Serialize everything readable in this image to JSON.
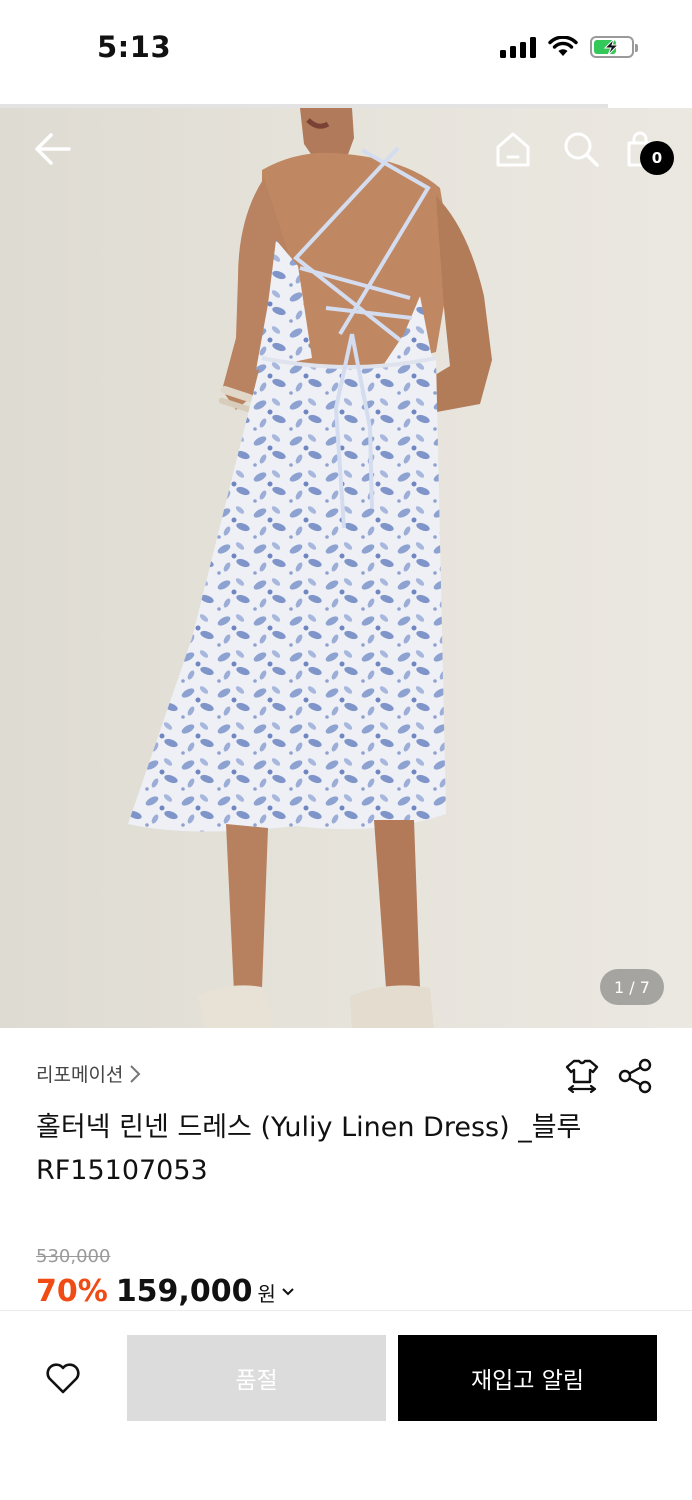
{
  "status_bar": {
    "time": "5:13",
    "icons": [
      "signal-icon",
      "wifi-icon",
      "battery-charging-icon"
    ]
  },
  "header": {
    "cart_count": "0",
    "icons": [
      "back-arrow-icon",
      "home-icon",
      "search-icon",
      "shopping-bag-icon"
    ]
  },
  "gallery": {
    "counter": "1 / 7",
    "current": 1,
    "total": 7
  },
  "product": {
    "brand": "리포메이션",
    "title": "홀터넥 린넨 드레스 (Yuliy Linen Dress) _블루",
    "code": "RF15107053",
    "original_price": "530,000",
    "discount_rate": "70%",
    "sale_price": "159,000",
    "currency": "원"
  },
  "actions": {
    "soldout_label": "품절",
    "restock_label": "재입고 알림",
    "icons": [
      "heart-icon",
      "size-guide-icon",
      "share-icon",
      "chevron-down-icon"
    ]
  },
  "colors": {
    "accent": "#f04b15",
    "primary_button": "#000000",
    "disabled_button": "#dcdcdc",
    "dress_pattern": "#7f95c9"
  }
}
